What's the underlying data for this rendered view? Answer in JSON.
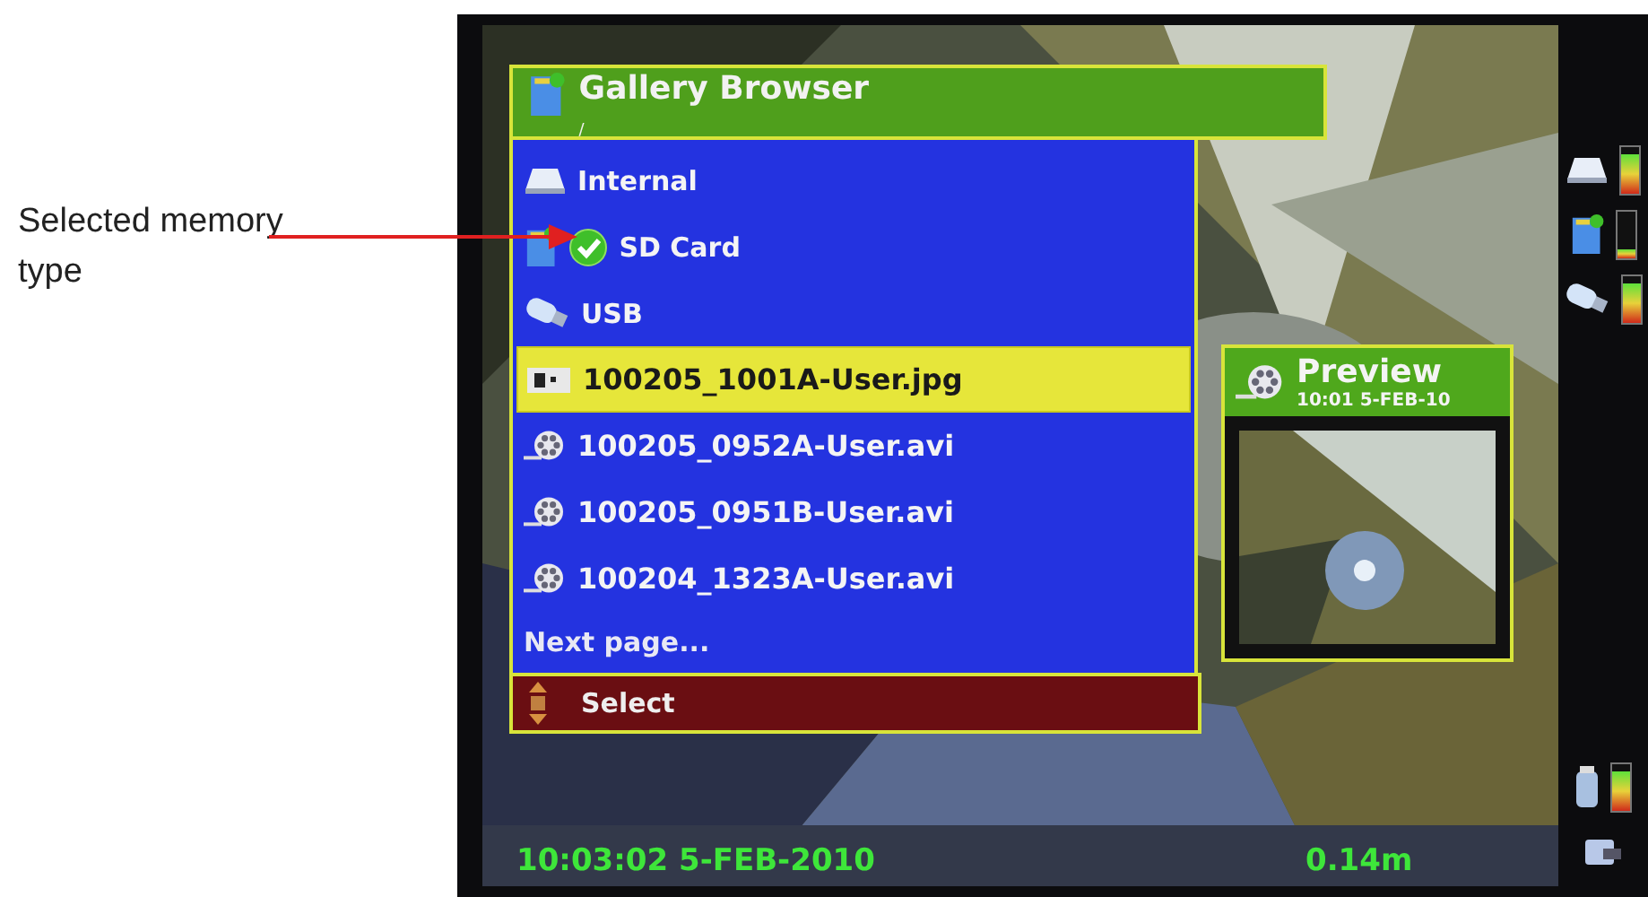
{
  "annotation": {
    "text": "Selected memory type"
  },
  "gallery": {
    "title": "Gallery Browser",
    "path": "/",
    "storage": [
      {
        "kind": "internal",
        "label": "Internal",
        "selected": false
      },
      {
        "kind": "sd",
        "label": "SD Card",
        "selected": true
      },
      {
        "kind": "usb",
        "label": "USB",
        "selected": false
      }
    ],
    "files": [
      {
        "name": "100205_1001A-User.jpg",
        "selected": true
      },
      {
        "kind": "video",
        "name": "100205_0952A-User.avi",
        "selected": false
      },
      {
        "kind": "video",
        "name": "100205_0951B-User.avi",
        "selected": false
      },
      {
        "kind": "video",
        "name": "100204_1323A-User.avi",
        "selected": false
      }
    ],
    "next_page": "Next page...",
    "action": "Select"
  },
  "preview": {
    "title": "Preview",
    "timestamp": "10:01 5-FEB-10"
  },
  "status": {
    "datetime": "10:03:02 5-FEB-2010",
    "distance": "0.14m"
  },
  "meters": [
    {
      "kind": "internal",
      "level": 0.85
    },
    {
      "kind": "sd",
      "level": 0.2
    },
    {
      "kind": "usb",
      "level": 0.85
    },
    {
      "kind": "battery",
      "level": 0.85
    }
  ]
}
